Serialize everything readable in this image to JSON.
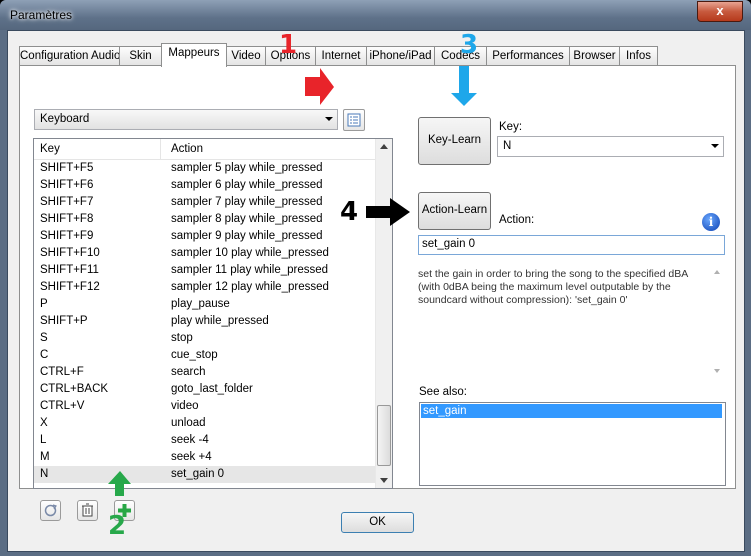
{
  "window": {
    "title": "Paramètres",
    "close_label": "x"
  },
  "tabs": [
    {
      "label": "Configuration Audio"
    },
    {
      "label": "Skin"
    },
    {
      "label": "Mappeurs",
      "active": true
    },
    {
      "label": "Video"
    },
    {
      "label": "Options"
    },
    {
      "label": "Internet"
    },
    {
      "label": "iPhone/iPad"
    },
    {
      "label": "Codecs"
    },
    {
      "label": "Performances"
    },
    {
      "label": "Browser"
    },
    {
      "label": "Infos"
    }
  ],
  "mapper_select": {
    "value": "Keyboard"
  },
  "table": {
    "headers": {
      "key": "Key",
      "action": "Action"
    },
    "rows": [
      {
        "key": "SHIFT+F5",
        "action": "sampler 5 play while_pressed"
      },
      {
        "key": "SHIFT+F6",
        "action": "sampler 6 play while_pressed"
      },
      {
        "key": "SHIFT+F7",
        "action": "sampler 7 play while_pressed"
      },
      {
        "key": "SHIFT+F8",
        "action": "sampler 8 play while_pressed"
      },
      {
        "key": "SHIFT+F9",
        "action": "sampler 9 play while_pressed"
      },
      {
        "key": "SHIFT+F10",
        "action": "sampler 10 play while_pressed"
      },
      {
        "key": "SHIFT+F11",
        "action": "sampler 11 play while_pressed"
      },
      {
        "key": "SHIFT+F12",
        "action": "sampler 12 play while_pressed"
      },
      {
        "key": "P",
        "action": "play_pause"
      },
      {
        "key": "SHIFT+P",
        "action": "play while_pressed"
      },
      {
        "key": "S",
        "action": "stop"
      },
      {
        "key": "C",
        "action": "cue_stop"
      },
      {
        "key": "CTRL+F",
        "action": "search"
      },
      {
        "key": "CTRL+BACK",
        "action": "goto_last_folder"
      },
      {
        "key": "CTRL+V",
        "action": "video"
      },
      {
        "key": "X",
        "action": "unload"
      },
      {
        "key": "L",
        "action": "seek -4"
      },
      {
        "key": "M",
        "action": "seek +4"
      },
      {
        "key": "N",
        "action": "set_gain 0",
        "selected": true
      }
    ]
  },
  "key_learn": {
    "button_label": "Key-Learn",
    "key_label": "Key:",
    "key_value": "N"
  },
  "action_learn": {
    "button_label": "Action-Learn",
    "action_label": "Action:",
    "action_value": "set_gain 0"
  },
  "description": "set the gain in order to bring the song to the specified dBA (with 0dBA being the maximum level outputable by the soundcard without compression): 'set_gain 0'",
  "see_also": {
    "label": "See also:",
    "items": [
      "set_gain"
    ]
  },
  "ok_label": "OK",
  "annotations": {
    "n1": "1",
    "n2": "2",
    "n3": "3",
    "n4": "4",
    "colors": {
      "red": "#e8242a",
      "green": "#27a84a",
      "blue": "#1ea7ea",
      "black": "#000000"
    }
  }
}
